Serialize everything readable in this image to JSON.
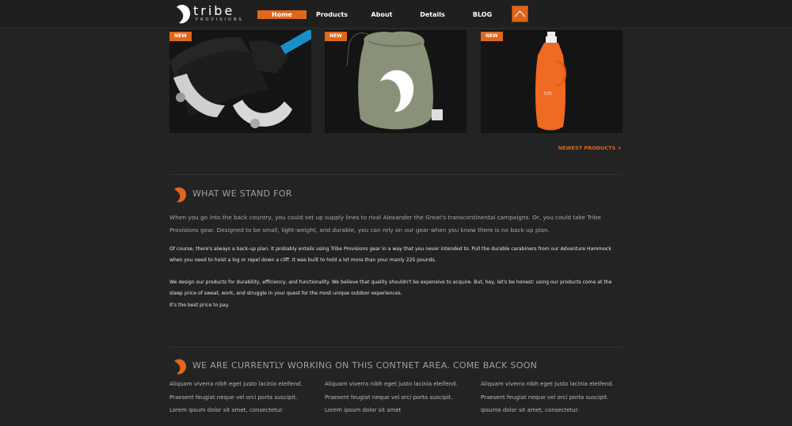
{
  "brand": {
    "name": "tribe",
    "tagline": "PROVISIONS"
  },
  "nav": {
    "items": [
      {
        "label": "Home",
        "active": true
      },
      {
        "label": "Products"
      },
      {
        "label": "About"
      },
      {
        "label": "Details"
      },
      {
        "label": "BLOG"
      }
    ]
  },
  "products": [
    {
      "badge": "NEW",
      "subject": "carabiner-strap"
    },
    {
      "badge": "NEW",
      "subject": "hammock-bag"
    },
    {
      "badge": "NEW",
      "subject": "water-bottle"
    }
  ],
  "newest_link": "NEWEST PRODUCTS +",
  "stand": {
    "title": "WHAT WE STAND FOR",
    "intro": "When you go into the back country, you could set up supply lines to rival Alexander the Great's transcontinental campaigns. Or, you could take Tribe Provisions gear. Designed to be small, light-weight, and durable, you can rely on our gear when you know there is no back-up plan.",
    "p2": "Of course, there's always a back-up plan. It probably entails using Tribe Provisions gear in a way that you never intended to. Pull the durable carabiners from our Adventure Hammock when you need to hoist a log or repel down a cliff. It was built to hold a lot more than your manly 225 pounds.",
    "p3a": "We design our products for durability, efficiency, and functionality. We believe that quality shouldn't be expensive to acquire. But, hey, let's be honest: using our products come at the steep price of sweat, work, and struggle in your quest for the most unique outdoor experiences.",
    "p3b": "It's the best price to pay."
  },
  "working": {
    "title": "WE ARE CURRENTLY WORKING ON THIS CONTNET AREA. COME BACK SOON",
    "columns": [
      [
        "Aliquam viverra nibh eget justo lacinia eleifend.",
        "Praesent feugiat neque vel orci porta suscipit.",
        "Lorem ipsum dolor sit amet, consectetur."
      ],
      [
        "Aliquam viverra nibh eget justo lacinia eleifend.",
        "Praesent feugiat neque vel orci porta suscipit.",
        "Lorem ipsum dolor sit amet"
      ],
      [
        "Aliquam viverra nibh eget justo lacinia eleifend.",
        "Praesent feugiat neque vel orci porta suscipit.",
        "Ipsumo dolor sit amet, consectetur."
      ]
    ]
  },
  "colors": {
    "accent": "#e0661b",
    "background": "#232323"
  }
}
